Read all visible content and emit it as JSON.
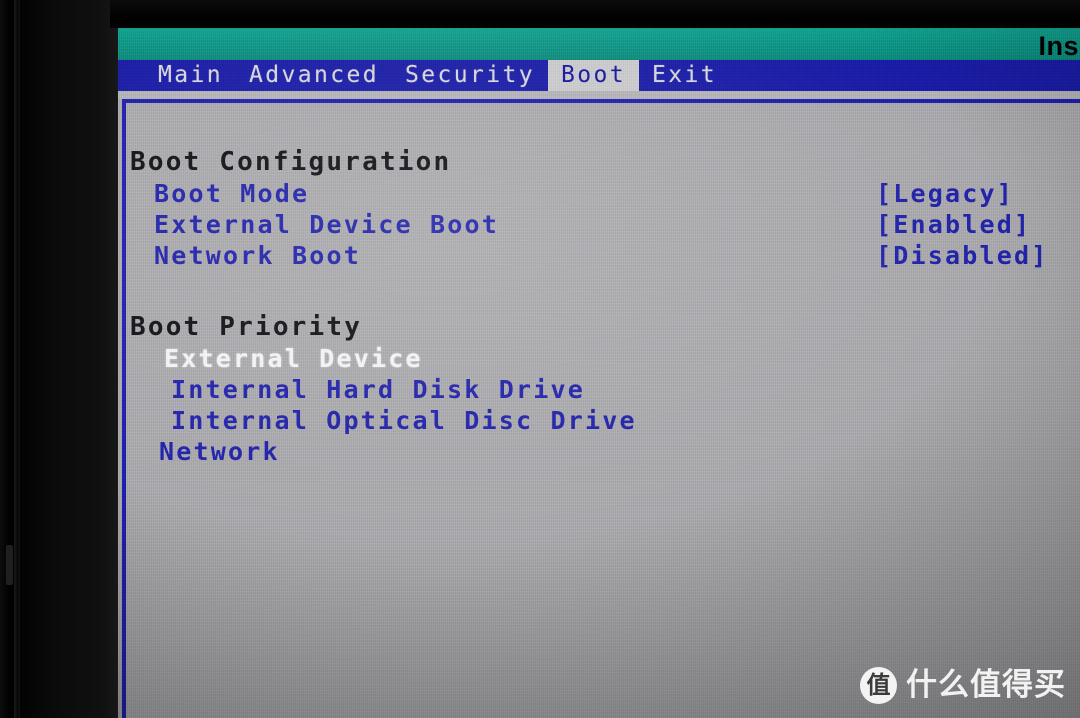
{
  "header": {
    "title": "Ins"
  },
  "menubar": {
    "tabs": [
      {
        "label": "Main",
        "selected": false
      },
      {
        "label": "Advanced",
        "selected": false
      },
      {
        "label": "Security",
        "selected": false
      },
      {
        "label": "Boot",
        "selected": true
      },
      {
        "label": "Exit",
        "selected": false
      }
    ]
  },
  "sections": [
    {
      "title": "Boot Configuration",
      "rows": [
        {
          "label": "Boot Mode",
          "value": "[Legacy]",
          "indent": 36,
          "selected": false
        },
        {
          "label": "External Device Boot",
          "value": "[Enabled]",
          "indent": 36,
          "selected": false
        },
        {
          "label": "Network Boot",
          "value": "[Disabled]",
          "indent": 36,
          "selected": false
        }
      ]
    },
    {
      "title": "Boot Priority",
      "rows": [
        {
          "label": "External Device",
          "value": "",
          "indent": 46,
          "selected": true
        },
        {
          "label": "Internal Hard Disk Drive",
          "value": "",
          "indent": 53,
          "selected": false
        },
        {
          "label": "Internal Optical Disc Drive",
          "value": "",
          "indent": 53,
          "selected": false
        },
        {
          "label": "Network",
          "value": "",
          "indent": 41,
          "selected": false
        }
      ]
    }
  ],
  "watermark": {
    "logo": "值",
    "text": "什么值得买"
  },
  "colors": {
    "header_teal": "#0e9585",
    "menubar_blue": "#1a1ca6",
    "panel_bg": "#a9a9ad",
    "text_blue": "#2323ab",
    "text_dark": "#111116",
    "text_selected": "#f2f2f4",
    "tab_selected_bg": "#c9c9cb"
  }
}
